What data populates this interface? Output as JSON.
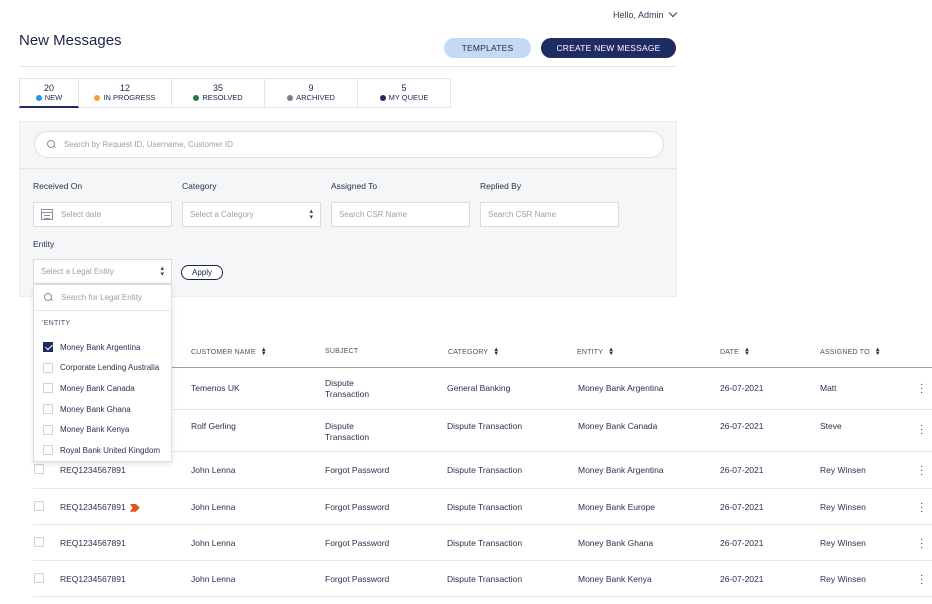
{
  "header": {
    "greeting": "Hello, Admin"
  },
  "page": {
    "title": "New Messages"
  },
  "actions": {
    "templates_label": "TEMPLATES",
    "create_label": "CREATE NEW MESSAGE"
  },
  "tabs": [
    {
      "count": "20",
      "label": "NEW",
      "color": "#1b9be8"
    },
    {
      "count": "12",
      "label": "IN PROGRESS",
      "color": "#f2a234"
    },
    {
      "count": "35",
      "label": "RESOLVED",
      "color": "#1f7a4a"
    },
    {
      "count": "9",
      "label": "ARCHIVED",
      "color": "#7d7f86"
    },
    {
      "count": "5",
      "label": "MY QUEUE",
      "color": "#1f2b63"
    }
  ],
  "filters": {
    "search_placeholder": "Search by Request ID, Username, Customer ID",
    "received_on_label": "Received On",
    "received_on_placeholder": "Select date",
    "category_label": "Category",
    "category_placeholder": "Select a Category",
    "assigned_to_label": "Assigned To",
    "assigned_to_placeholder": "Search CSR Name",
    "replied_by_label": "Replied By",
    "replied_by_placeholder": "Search CSR Name",
    "entity_label": "Entity",
    "entity_placeholder": "Select a Legal Entity",
    "apply_label": "Apply"
  },
  "entity_dropdown": {
    "search_placeholder": "Search for Legal Entity",
    "heading": "'ENTITY",
    "items": [
      {
        "label": "Money Bank Argentina",
        "checked": true
      },
      {
        "label": "Corporate Lending Australia",
        "checked": false
      },
      {
        "label": "Money Bank Canada",
        "checked": false
      },
      {
        "label": "Money Bank Ghana",
        "checked": false
      },
      {
        "label": "Money Bank Kenya",
        "checked": false
      },
      {
        "label": "Royal Bank United Kingdom",
        "checked": false
      }
    ]
  },
  "table": {
    "columns": {
      "customer_name": "CUSTOMER NAME",
      "subject": "SUBJECT",
      "category": "CATEGORY",
      "entity": "ENTITY",
      "date": "DATE",
      "assigned_to": "ASSIGNED TO"
    },
    "rows": [
      {
        "request_id": "",
        "flag": false,
        "customer": "Temenos UK",
        "subject_1": "Dispute",
        "subject_2": "Transaction",
        "category": "General Banking",
        "entity": "Money Bank Argentina",
        "date": "26-07-2021",
        "assigned": "Matt"
      },
      {
        "request_id": "",
        "flag": false,
        "customer": "Rolf Gerling",
        "subject_1": "Dispute",
        "subject_2": "Transaction",
        "category": "Dispute Transaction",
        "entity": "Money Bank Canada",
        "date": "26-07-2021",
        "assigned": "Steve"
      },
      {
        "request_id": "REQ1234567891",
        "flag": false,
        "customer": "John Lenna",
        "subject_1": "Forgot Password",
        "subject_2": "",
        "category": "Dispute Transaction",
        "entity": "Money Bank Argentina",
        "date": "26-07-2021",
        "assigned": "Rey Winsen"
      },
      {
        "request_id": "REQ1234567891",
        "flag": true,
        "customer": "John Lenna",
        "subject_1": "Forgot Password",
        "subject_2": "",
        "category": "Dispute Transaction",
        "entity": "Money Bank Europe",
        "date": "26-07-2021",
        "assigned": "Rey Winsen"
      },
      {
        "request_id": "REQ1234567891",
        "flag": false,
        "customer": "John Lenna",
        "subject_1": "Forgot Password",
        "subject_2": "",
        "category": "Dispute Transaction",
        "entity": "Money Bank Ghana",
        "date": "26-07-2021",
        "assigned": "Rey Winsen"
      },
      {
        "request_id": "REQ1234567891",
        "flag": false,
        "customer": "John Lenna",
        "subject_1": "Forgot Password",
        "subject_2": "",
        "category": "Dispute Transaction",
        "entity": "Money Bank Kenya",
        "date": "26-07-2021",
        "assigned": "Rey Winsen"
      }
    ]
  }
}
